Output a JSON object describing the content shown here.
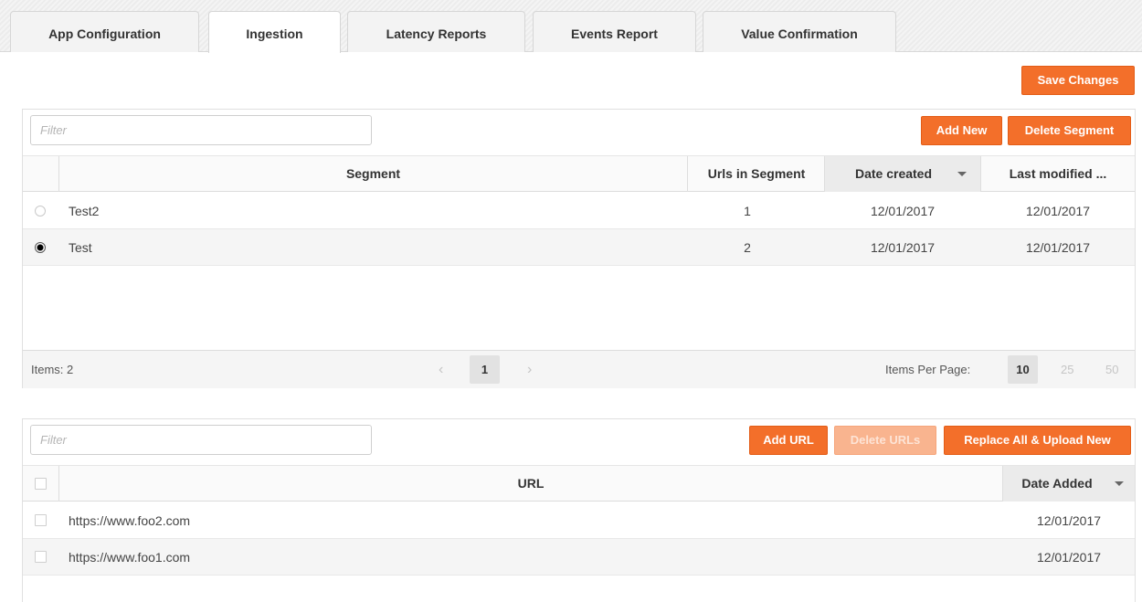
{
  "tabs": [
    {
      "label": "App Configuration"
    },
    {
      "label": "Ingestion"
    },
    {
      "label": "Latency Reports"
    },
    {
      "label": "Events Report"
    },
    {
      "label": "Value Confirmation"
    }
  ],
  "active_tab": "Ingestion",
  "save_changes_label": "Save Changes",
  "segments": {
    "filter_placeholder": "Filter",
    "add_new_label": "Add New",
    "delete_segment_label": "Delete Segment",
    "columns": [
      "Segment",
      "Urls in Segment",
      "Date created",
      "Last modified ..."
    ],
    "sorted_column": "Date created",
    "rows": [
      {
        "selected": false,
        "segment": "Test2",
        "urls": "1",
        "created": "12/01/2017",
        "modified": "12/01/2017"
      },
      {
        "selected": true,
        "segment": "Test",
        "urls": "2",
        "created": "12/01/2017",
        "modified": "12/01/2017"
      }
    ],
    "pager": {
      "items_text": "Items: 2",
      "prev": "‹",
      "current_page": "1",
      "next": "›",
      "per_page_label": "Items Per Page:",
      "per_page_options": [
        "10",
        "25",
        "50"
      ],
      "per_page_selected": "10"
    }
  },
  "urls": {
    "filter_placeholder": "Filter",
    "add_url_label": "Add URL",
    "delete_urls_label": "Delete URLs",
    "replace_label": "Replace All & Upload New",
    "columns": [
      "URL",
      "Date Added"
    ],
    "rows": [
      {
        "checked": false,
        "url": "https://www.foo2.com",
        "date": "12/01/2017"
      },
      {
        "checked": false,
        "url": "https://www.foo1.com",
        "date": "12/01/2017"
      }
    ]
  },
  "colors": {
    "accent": "#f36f2a",
    "accent_disabled": "#f9b48f"
  }
}
